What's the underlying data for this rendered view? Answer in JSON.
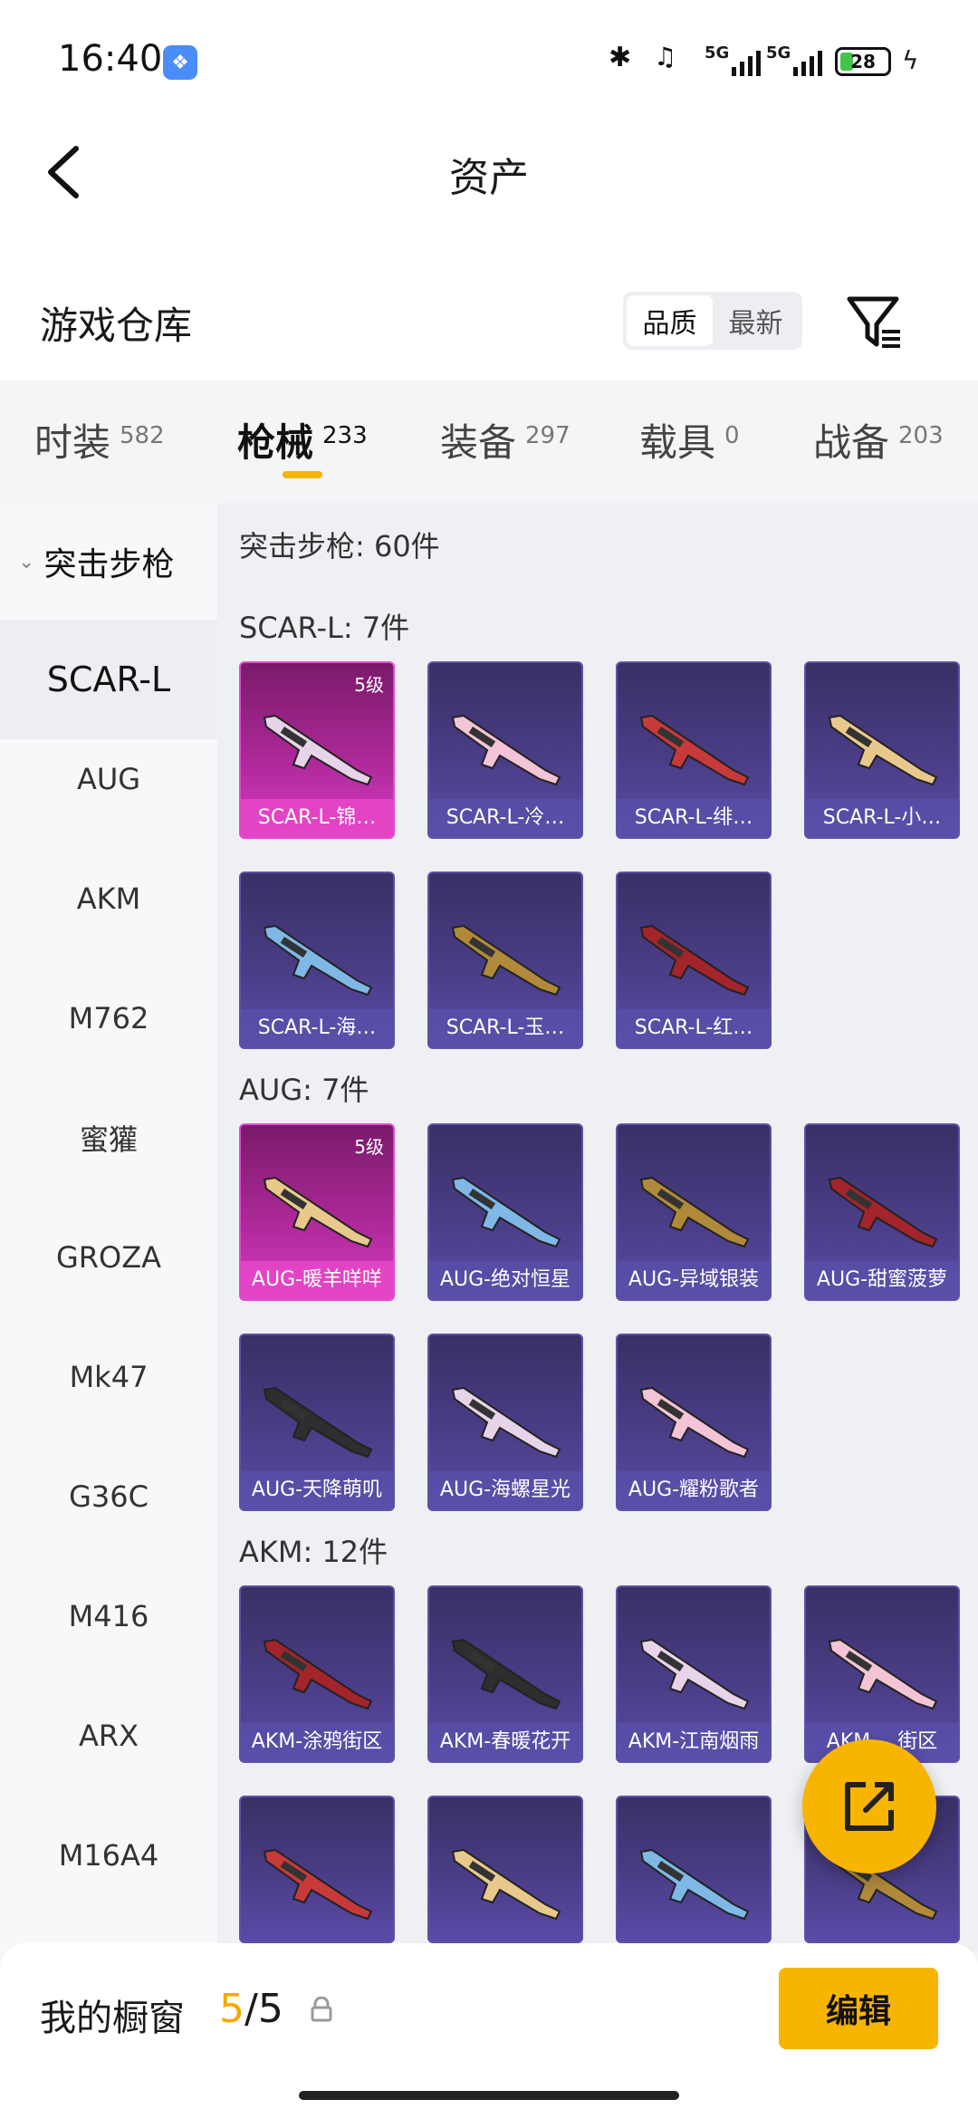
{
  "status_bar": {
    "time": "16:40",
    "battery": "28",
    "battery_level": 0.28,
    "signal1": "5G",
    "signal2": "5G"
  },
  "header": {
    "title": "资产"
  },
  "warehouse": {
    "title": "游戏仓库",
    "sort_options": [
      "品质",
      "最新"
    ],
    "active_sort": "品质"
  },
  "tabs": [
    {
      "label": "时装",
      "count": "582"
    },
    {
      "label": "枪械",
      "count": "233"
    },
    {
      "label": "装备",
      "count": "297"
    },
    {
      "label": "载具",
      "count": "0"
    },
    {
      "label": "战备",
      "count": "203"
    }
  ],
  "active_tab": "枪械",
  "sidebar": {
    "category": "突击步枪",
    "items": [
      "SCAR-L",
      "AUG",
      "AKM",
      "M762",
      "蜜獾",
      "GROZA",
      "Mk47",
      "G36C",
      "M416",
      "ARX",
      "M16A4"
    ],
    "active": "SCAR-L"
  },
  "content": {
    "total_title": "突击步枪: 60件",
    "sections": [
      {
        "title": "SCAR-L: 7件",
        "items": [
          {
            "name": "SCAR-L-锦…",
            "level": "5级",
            "rarity": "pink"
          },
          {
            "name": "SCAR-L-冷…"
          },
          {
            "name": "SCAR-L-绯…"
          },
          {
            "name": "SCAR-L-小…"
          },
          {
            "name": "SCAR-L-海…"
          },
          {
            "name": "SCAR-L-玉…"
          },
          {
            "name": "SCAR-L-红…"
          }
        ]
      },
      {
        "title": "AUG: 7件",
        "items": [
          {
            "name": "AUG-暖羊咩咩",
            "level": "5级",
            "rarity": "pink"
          },
          {
            "name": "AUG-绝对恒星"
          },
          {
            "name": "AUG-异域银装"
          },
          {
            "name": "AUG-甜蜜菠萝"
          },
          {
            "name": "AUG-天降萌叽"
          },
          {
            "name": "AUG-海螺星光"
          },
          {
            "name": "AUG-耀粉歌者"
          }
        ]
      },
      {
        "title": "AKM: 12件",
        "items": [
          {
            "name": "AKM-涂鸦街区"
          },
          {
            "name": "AKM-春暖花开"
          },
          {
            "name": "AKM-江南烟雨"
          },
          {
            "name": "AKM-…街区"
          },
          {
            "name": ""
          },
          {
            "name": ""
          },
          {
            "name": ""
          },
          {
            "name": ""
          }
        ]
      }
    ]
  },
  "bottom": {
    "label": "我的橱窗",
    "current": "5",
    "separator": "/",
    "max": "5",
    "edit_label": "编辑"
  },
  "colors": {
    "accent": "#f7b500",
    "card_purple": "#4a3d86",
    "card_pink": "#c631b0"
  },
  "icons": {
    "back": "chevron-left-icon",
    "filter": "filter-icon",
    "fab": "share-external-icon",
    "lock": "lock-icon"
  }
}
